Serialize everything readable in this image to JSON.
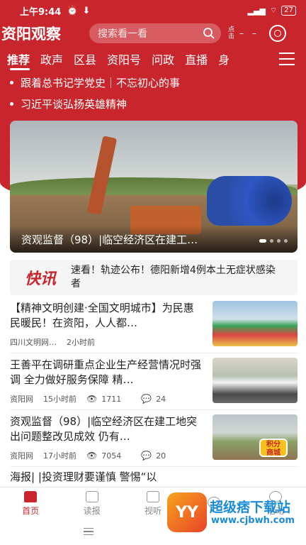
{
  "status_bar": {
    "time": "上午9:44",
    "battery": "27"
  },
  "header": {
    "logo": "资阳观察",
    "search_placeholder": "搜索看一看",
    "click_label": "点击"
  },
  "nav_tabs": [
    "推荐",
    "政声",
    "区县",
    "资阳号",
    "问政",
    "直播",
    "身"
  ],
  "headlines": [
    "跟着总书记学党史｜不忘初心的事",
    "习近平谈弘扬英雄精神"
  ],
  "hero": {
    "caption": "资观监督（98）|临空经济区在建工…"
  },
  "flash": {
    "logo": "快讯",
    "text": "速看！轨迹公布！德阳新增4例本土无症状感染者"
  },
  "articles": [
    {
      "title": "【精神文明创建·全国文明城市】为民惠民暖民！在资阳，人人都…",
      "source": "四川文明网…",
      "time": "2小时前",
      "views": "",
      "comments": ""
    },
    {
      "title": "王善平在调研重点企业生产经营情况时强调 全力做好服务保障 精…",
      "source": "资阳网",
      "time": "15小时前",
      "views": "1711",
      "comments": "24"
    },
    {
      "title": "资观监督（98）|临空经济区在建工地突出问题整改见成效 仍有…",
      "source": "资阳网",
      "time": "17小时前",
      "views": "7054",
      "comments": "20"
    },
    {
      "title": "海报| |投资理财要谨慎 警惕“以",
      "source": "",
      "time": "",
      "views": "",
      "comments": ""
    }
  ],
  "badge": {
    "line1": "积分",
    "line2": "商城"
  },
  "bottom_nav": [
    "首页",
    "读报",
    "视听",
    "",
    "活动"
  ],
  "watermark": {
    "logo": "YY",
    "text": "超级痞下载站",
    "url": "www.cjbwh.com"
  },
  "colors": {
    "brand_red": "#c8262c"
  }
}
